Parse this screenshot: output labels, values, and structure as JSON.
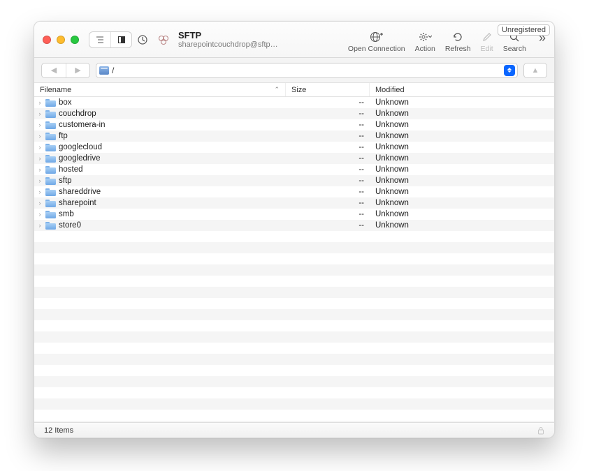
{
  "badge": "Unregistered",
  "title": "SFTP",
  "subtitle": "sharepointcouchdrop@sftp…",
  "toolbar": {
    "open_connection": "Open Connection",
    "action": "Action",
    "refresh": "Refresh",
    "edit": "Edit",
    "search": "Search"
  },
  "path": "/",
  "columns": {
    "filename": "Filename",
    "size": "Size",
    "modified": "Modified"
  },
  "files": [
    {
      "name": "box",
      "size": "--",
      "modified": "Unknown"
    },
    {
      "name": "couchdrop",
      "size": "--",
      "modified": "Unknown"
    },
    {
      "name": "customera-in",
      "size": "--",
      "modified": "Unknown"
    },
    {
      "name": "ftp",
      "size": "--",
      "modified": "Unknown"
    },
    {
      "name": "googlecloud",
      "size": "--",
      "modified": "Unknown"
    },
    {
      "name": "googledrive",
      "size": "--",
      "modified": "Unknown"
    },
    {
      "name": "hosted",
      "size": "--",
      "modified": "Unknown"
    },
    {
      "name": "sftp",
      "size": "--",
      "modified": "Unknown"
    },
    {
      "name": "shareddrive",
      "size": "--",
      "modified": "Unknown"
    },
    {
      "name": "sharepoint",
      "size": "--",
      "modified": "Unknown"
    },
    {
      "name": "smb",
      "size": "--",
      "modified": "Unknown"
    },
    {
      "name": "store0",
      "size": "--",
      "modified": "Unknown"
    }
  ],
  "status": "12 Items"
}
